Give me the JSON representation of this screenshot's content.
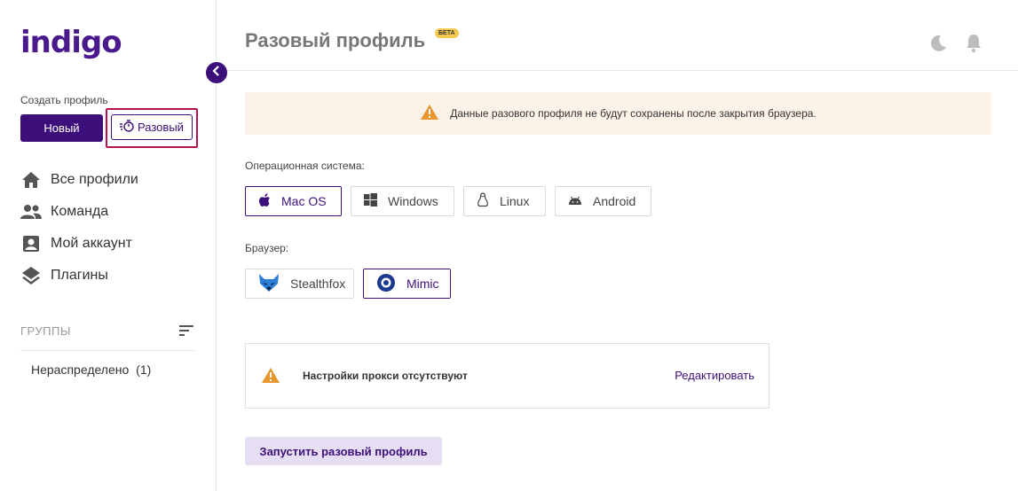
{
  "sidebar": {
    "logo": "indigo",
    "create_label": "Создать профиль",
    "new_button": "Новый",
    "onetime_button": "Разовый",
    "nav": [
      {
        "label": "Все профили",
        "icon": "home-icon"
      },
      {
        "label": "Команда",
        "icon": "team-icon"
      },
      {
        "label": "Мой аккаунт",
        "icon": "account-icon"
      },
      {
        "label": "Плагины",
        "icon": "layers-icon"
      }
    ],
    "groups_label": "ГРУППЫ",
    "group_item": "Нераспределено",
    "group_count": "(1)"
  },
  "header": {
    "title": "Разовый профиль",
    "badge": "БЕТА"
  },
  "warning_text": "Данные разового профиля не будут сохранены после закрытия браузера.",
  "os": {
    "label": "Операционная система:",
    "options": [
      "Mac OS",
      "Windows",
      "Linux",
      "Android"
    ],
    "selected": "Mac OS"
  },
  "browser": {
    "label": "Браузер:",
    "options": [
      "Stealthfox",
      "Mimic"
    ],
    "selected": "Mimic"
  },
  "proxy": {
    "text": "Настройки прокси отсутствуют",
    "edit": "Редактировать"
  },
  "launch_button": "Запустить разовый профиль",
  "colors": {
    "brand": "#3d0f7a",
    "highlight": "#b5124f",
    "warning_bg": "#fcf2e8",
    "warning_icon": "#e8962e"
  }
}
